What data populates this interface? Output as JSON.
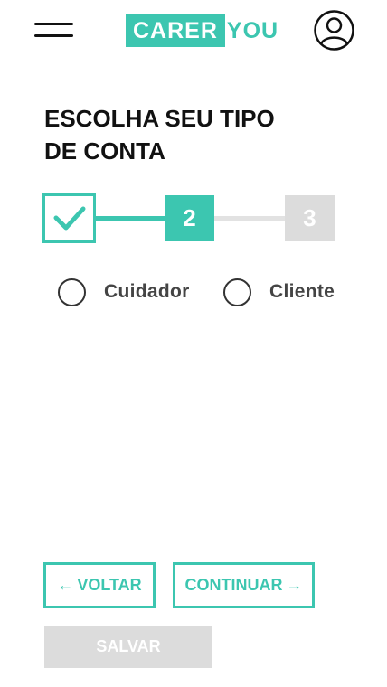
{
  "header": {
    "logo_main": "CARER",
    "logo_tail": "YOU",
    "menu_icon": "hamburger-menu-icon",
    "profile_icon": "user-avatar-icon",
    "accent_color": "#3cc6b0"
  },
  "title": {
    "line1": "ESCOLHA SEU TIPO",
    "line2": "DE CONTA"
  },
  "stepper": {
    "step1_icon": "check-icon",
    "step2": "2",
    "step3": "3",
    "current_step": 2,
    "total_steps": 3
  },
  "options": {
    "caregiver": "Cuidador",
    "client": "Cliente",
    "selected": null
  },
  "buttons": {
    "back_arrow": "←",
    "back": "VOLTAR",
    "next": "CONTINUAR",
    "next_arrow": "→",
    "save": "SALVAR"
  }
}
